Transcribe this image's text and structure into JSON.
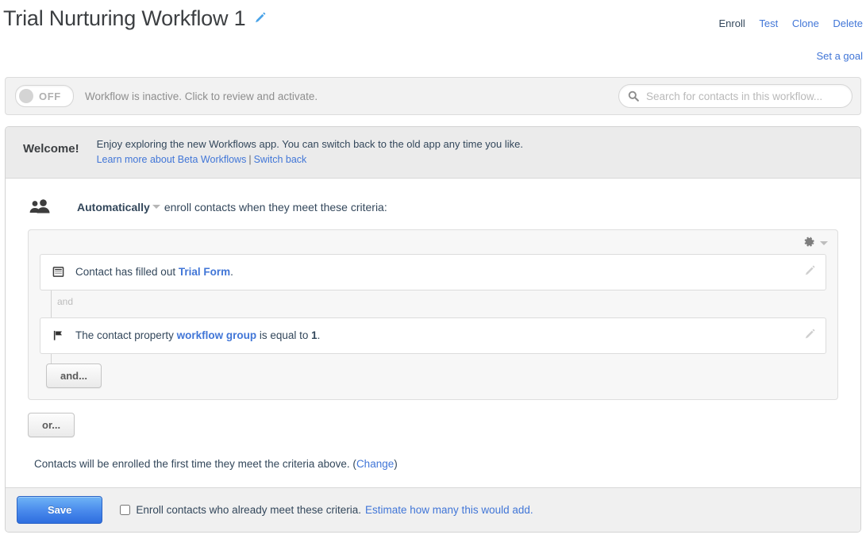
{
  "header": {
    "title": "Trial Nurturing Workflow 1",
    "edit_icon": "pencil-icon",
    "actions": [
      {
        "label": "Enroll",
        "style": "disabled"
      },
      {
        "label": "Test",
        "style": "link"
      },
      {
        "label": "Clone",
        "style": "link"
      },
      {
        "label": "Delete",
        "style": "link"
      }
    ],
    "set_goal_label": "Set a goal"
  },
  "toggle_bar": {
    "toggle_state": "OFF",
    "status_text": "Workflow is inactive. Click to review and activate.",
    "search_placeholder": "Search for contacts in this workflow...",
    "search_value": "",
    "search_icon": "search-icon"
  },
  "welcome": {
    "title": "Welcome!",
    "message": "Enjoy exploring the new Workflows app. You can switch back to the old app any time you like.",
    "link_learn_more": "Learn more about Beta Workflows",
    "separator": "|",
    "link_switch_back": "Switch back"
  },
  "enrollment": {
    "icon": "users-icon",
    "mode_label": "Automatically",
    "head_suffix": "enroll contacts when they meet these criteria:",
    "gear_icon": "gear-icon",
    "criteria": [
      {
        "icon": "form-icon",
        "prefix": "Contact has filled out ",
        "link": "Trial Form",
        "suffix": ".",
        "edit_icon": "pencil-icon"
      },
      {
        "icon": "flag-icon",
        "prefix": "The contact property ",
        "link": "workflow group",
        "middle": " is equal to ",
        "value": "1",
        "suffix": ".",
        "edit_icon": "pencil-icon"
      }
    ],
    "connector_label": "and",
    "and_button": "and...",
    "or_button": "or...",
    "note_text": "Contacts will be enrolled the first time they meet the criteria above. (",
    "note_link": "Change",
    "note_close": ")"
  },
  "footer": {
    "save_label": "Save",
    "checkbox_checked": false,
    "checkbox_label": "Enroll contacts who already meet these criteria.",
    "estimate_link": "Estimate how many this would add."
  },
  "colors": {
    "link_blue": "#4176d7",
    "save_blue": "#2e6ddf",
    "panel_gray": "#f7f7f7",
    "banner_gray": "#ebebeb"
  }
}
